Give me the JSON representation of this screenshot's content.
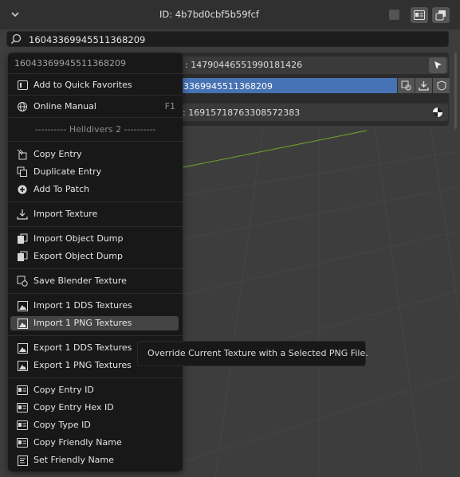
{
  "header": {
    "title": "ID: 4b7bd0cbf5b59fcf",
    "icons": [
      "chevron-down-icon",
      "checkbox",
      "id-card-icon",
      "copy-stack-icon"
    ]
  },
  "search": {
    "value": "16043369945511368209",
    "icon": "search-icon"
  },
  "panel": {
    "row1_text": ": 14790446551990181426",
    "row2_text": "3369945511368209",
    "row3_text": "l: 16915718763308572383"
  },
  "menu": {
    "title": "16043369945511368209",
    "items": [
      {
        "label": "Add to Quick Favorites",
        "icon": "quick-favorites-icon"
      },
      {
        "label": "Online Manual",
        "icon": "globe-icon",
        "shortcut": "F1"
      },
      {
        "label": "Copy Entry",
        "icon": "copy-entry-icon"
      },
      {
        "label": "Duplicate Entry",
        "icon": "duplicate-icon"
      },
      {
        "label": "Add To Patch",
        "icon": "add-circle-icon"
      },
      {
        "label": "Import Texture",
        "icon": "import-icon"
      },
      {
        "label": "Import Object Dump",
        "icon": "paste-icon"
      },
      {
        "label": "Export Object Dump",
        "icon": "paste-icon"
      },
      {
        "label": "Save Blender Texture",
        "icon": "save-texture-icon"
      },
      {
        "label": "Import 1 DDS Textures",
        "icon": "image-icon"
      },
      {
        "label": "Import 1 PNG Textures",
        "icon": "image-icon"
      },
      {
        "label": "Export 1 DDS Textures",
        "icon": "image-icon"
      },
      {
        "label": "Export 1 PNG Textures",
        "icon": "image-icon"
      },
      {
        "label": "Copy Entry ID",
        "icon": "id-card-icon"
      },
      {
        "label": "Copy Entry Hex ID",
        "icon": "id-card-icon"
      },
      {
        "label": "Copy Type ID",
        "icon": "id-card-icon"
      },
      {
        "label": "Copy Friendly Name",
        "icon": "id-card-icon"
      },
      {
        "label": "Set Friendly Name",
        "icon": "text-icon"
      }
    ],
    "section_label": "---------- Helldivers 2 ----------",
    "highlighted": "Import 1 PNG Textures"
  },
  "tooltip": {
    "text": "Override Current Texture with a Selected PNG File."
  },
  "colors": {
    "accent": "#4772b3",
    "menu_bg": "#181818",
    "highlight": "#444444",
    "grid_line": "#6a9a2a"
  }
}
